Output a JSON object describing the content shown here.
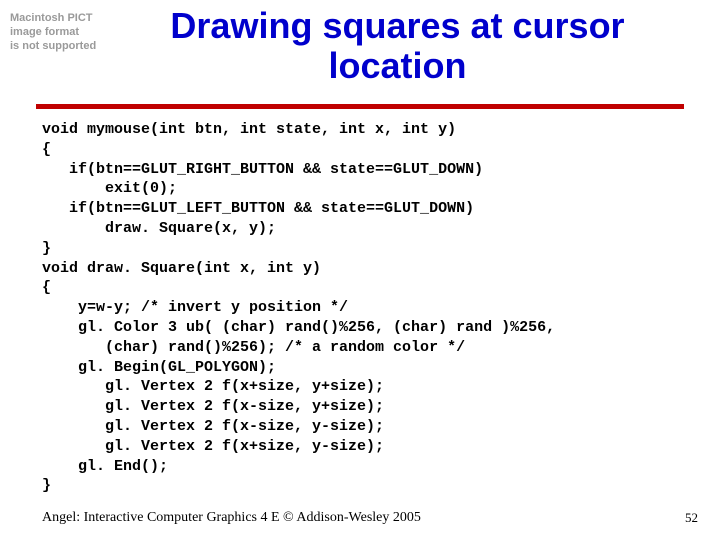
{
  "placeholder": {
    "line1": "Macintosh PICT",
    "line2": "image format",
    "line3": "is not supported"
  },
  "title": "Drawing squares at cursor location",
  "code": "void mymouse(int btn, int state, int x, int y)\n{\n   if(btn==GLUT_RIGHT_BUTTON && state==GLUT_DOWN)\n       exit(0);\n   if(btn==GLUT_LEFT_BUTTON && state==GLUT_DOWN)\n       draw. Square(x, y);\n}\nvoid draw. Square(int x, int y)\n{\n    y=w-y; /* invert y position */\n    gl. Color 3 ub( (char) rand()%256, (char) rand )%256,\n       (char) rand()%256); /* a random color */\n    gl. Begin(GL_POLYGON);\n       gl. Vertex 2 f(x+size, y+size);\n       gl. Vertex 2 f(x-size, y+size);\n       gl. Vertex 2 f(x-size, y-size);\n       gl. Vertex 2 f(x+size, y-size);\n    gl. End();\n}",
  "footer": "Angel: Interactive Computer Graphics 4 E © Addison-Wesley 2005",
  "page_number": "52"
}
